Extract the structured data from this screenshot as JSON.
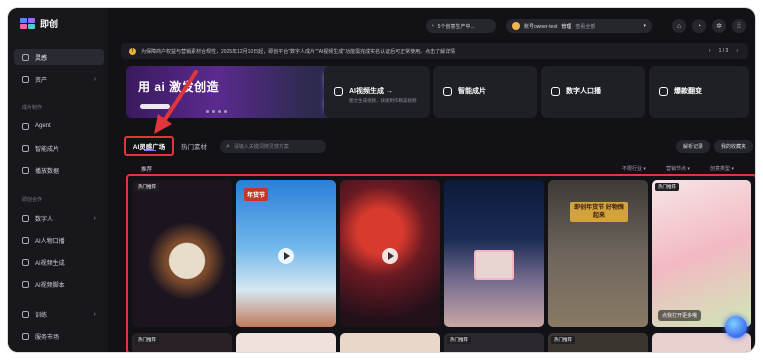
{
  "app": {
    "logo_text": "即创"
  },
  "sidebar": {
    "items": [
      {
        "label": "灵感",
        "active": true
      },
      {
        "label": "资产",
        "chevron": true
      },
      {
        "section": "成片制作"
      },
      {
        "label": "Agent"
      },
      {
        "label": "智能成片"
      },
      {
        "label": "播放数据"
      },
      {
        "section": "即创合作"
      },
      {
        "label": "数字人",
        "chevron": true
      },
      {
        "label": "AI人物口播"
      },
      {
        "label": "AI视频生成"
      },
      {
        "label": "AI视频脚本"
      },
      {
        "label": "训练",
        "chevron": true
      },
      {
        "label": "服务市场"
      }
    ]
  },
  "topbar": {
    "task_button": "5个创意生产中...",
    "account_label": "账号owner-test",
    "account_role": "管理",
    "account_switch": "查看全部",
    "icons": [
      "shop-icon",
      "bell-icon",
      "gear-icon",
      "apps-icon"
    ]
  },
  "notice": {
    "text": "为保障商户权益与营销素材合规性，2025年12月10日起，即创平台\"数字人成片\"\"AI视频生成\"功能需完成实名认证后可正常使用。点击了解详情",
    "pager": "1 / 3"
  },
  "feature_cards": {
    "banner_title": "用 ai 激发创造",
    "blurred_text": "CA",
    "cards": [
      {
        "label": "AI视频生成 →",
        "sub": "图文生成视频，快速制作精美视频",
        "icon": "video-icon"
      },
      {
        "label": "智能成片",
        "sub": "",
        "icon": "film-icon"
      },
      {
        "label": "数字人口播",
        "sub": "",
        "icon": "avatar-icon"
      },
      {
        "label": "爆款翻变",
        "sub": "",
        "icon": "refresh-icon"
      }
    ]
  },
  "tabs": {
    "inspiration": "AI灵感广场",
    "hot_assets": "热门素材",
    "search_placeholder": "请输入关键词搜灵感方案",
    "history": "解析记录",
    "collect": "我的收藏夹"
  },
  "filters": {
    "recommend": "推荐",
    "industry": "不限行业",
    "holiday": "营销节点",
    "type": "创意类型"
  },
  "gallery": {
    "tiles": [
      {
        "badge": "热门推荐",
        "caption": "",
        "note": ""
      },
      {
        "badge": "",
        "caption": "年货节",
        "note": ""
      },
      {
        "badge": "",
        "caption": "",
        "note": ""
      },
      {
        "badge": "",
        "caption": "",
        "note": ""
      },
      {
        "badge": "",
        "caption": "即创年货节 好物囤起来",
        "note": ""
      },
      {
        "badge": "热门推荐",
        "caption": "",
        "note": "点我打开更多哦"
      }
    ],
    "row2_badges": [
      "热门推荐",
      "",
      "",
      "热门推荐",
      "热门推荐",
      ""
    ]
  },
  "colors": {
    "highlight_red": "#e0353a",
    "accent_purple": "#8b6cf5",
    "background": "#121216"
  }
}
